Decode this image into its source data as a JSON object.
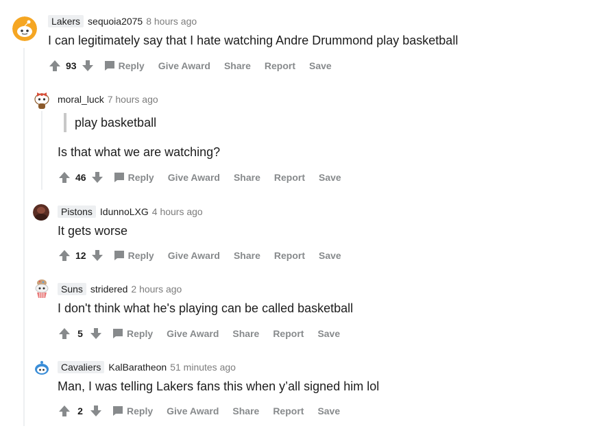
{
  "colors": {
    "arrow": "#878a8c",
    "text": "#1c1c1c",
    "meta": "#7c7c7c",
    "flair_bg": "#edeff1",
    "thread_line": "#edeff1"
  },
  "actions": {
    "reply": "Reply",
    "give_award": "Give Award",
    "share": "Share",
    "report": "Report",
    "save": "Save"
  },
  "comments": [
    {
      "flair": "Lakers",
      "user": "sequoia2075",
      "time": "8 hours ago",
      "text": "I can legitimately say that I hate watching Andre Drummond play basketball",
      "score": "93",
      "avatar_icon": "snoo-avatar-icon"
    },
    {
      "flair": "",
      "user": "moral_luck",
      "time": "7 hours ago",
      "quote": "play basketball",
      "text": "Is that what we are watching?",
      "score": "46",
      "avatar_icon": "snoo-bow-avatar-icon"
    },
    {
      "flair": "Pistons",
      "user": "IdunnoLXG",
      "time": "4 hours ago",
      "text": "It gets worse",
      "score": "12",
      "avatar_icon": "photo-avatar-icon"
    },
    {
      "flair": "Suns",
      "user": "stridered",
      "time": "2 hours ago",
      "text": "I don't think what he's playing can be called basketball",
      "score": "5",
      "avatar_icon": "snoo-cupcake-avatar-icon"
    },
    {
      "flair": "Cavaliers",
      "user": "KalBaratheon",
      "time": "51 minutes ago",
      "text": "Man, I was telling Lakers fans this when y’all signed him lol",
      "score": "2",
      "avatar_icon": "snoo-blue-avatar-icon"
    }
  ]
}
